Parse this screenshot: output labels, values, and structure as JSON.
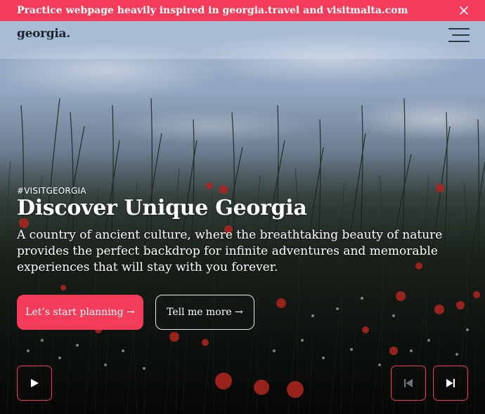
{
  "banner": {
    "text": "Practice webpage heavily inspired in georgia.travel and visitmalta.com",
    "close_icon": "close-icon",
    "color": "#f23c5a"
  },
  "header": {
    "logo": "georgia.",
    "menu_icon": "hamburger-menu-icon"
  },
  "hero": {
    "eyebrow": "#VISITGEORGIA",
    "title": "Discover Unique Georgia",
    "description": "A country of ancient culture, where the breathtaking beauty of nature provides the perfect backdrop for infinite adventures and memorable experiences that will stay with you forever."
  },
  "buttons": {
    "primary": "Let’s start planning →",
    "secondary": "Tell me more →"
  },
  "controls": {
    "play_icon": "play-icon",
    "previous_icon": "skip-previous-icon",
    "next_icon": "skip-next-icon"
  },
  "colors": {
    "accent": "#f23c5a",
    "text": "#ffffff",
    "logo": "#1d2430"
  }
}
